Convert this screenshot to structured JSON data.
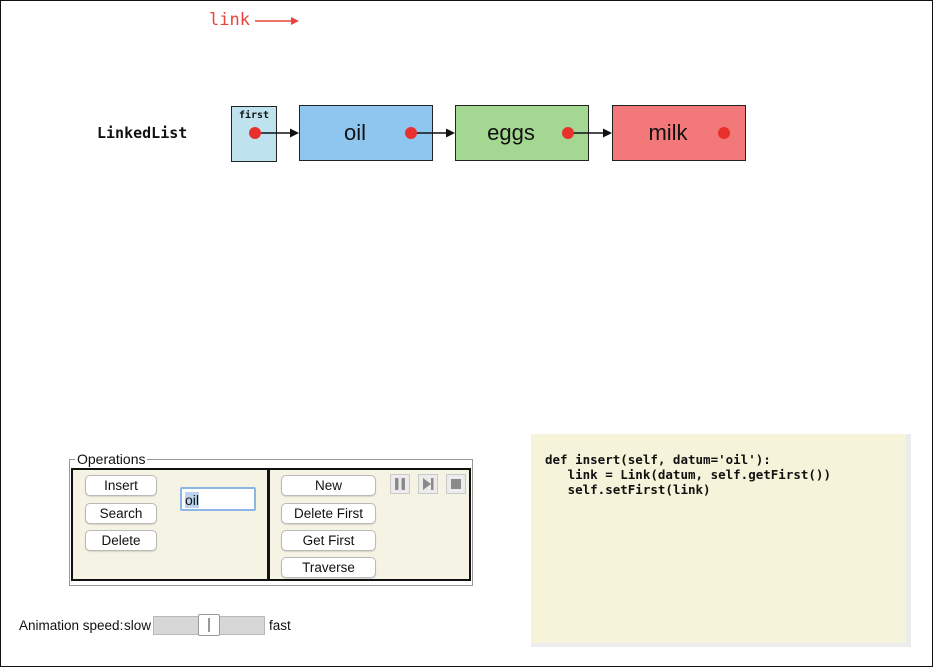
{
  "canvas": {
    "link_label": "link",
    "linked_list_label": "LinkedList",
    "first_label": "first",
    "nodes": [
      {
        "label": "oil",
        "color": "#8ec6ef"
      },
      {
        "label": "eggs",
        "color": "#a4d892"
      },
      {
        "label": "milk",
        "color": "#f3787a"
      }
    ],
    "first_color": "#bfe3ee",
    "pointer_color": "#e8302c"
  },
  "operations": {
    "title": "Operations",
    "buttons_left": [
      "Insert",
      "Search",
      "Delete"
    ],
    "input_value": "oil",
    "buttons_right": [
      "New",
      "Delete First",
      "Get First",
      "Traverse"
    ],
    "controls": [
      "pause-icon",
      "step-icon",
      "stop-icon"
    ]
  },
  "animation": {
    "label": "Animation speed:",
    "slow": "slow",
    "fast": "fast",
    "speed_fraction": 0.5
  },
  "code": {
    "lines": [
      "def insert(self, datum='oil'):",
      "   link = Link(datum, self.getFirst())",
      "   self.setFirst(link)"
    ]
  }
}
